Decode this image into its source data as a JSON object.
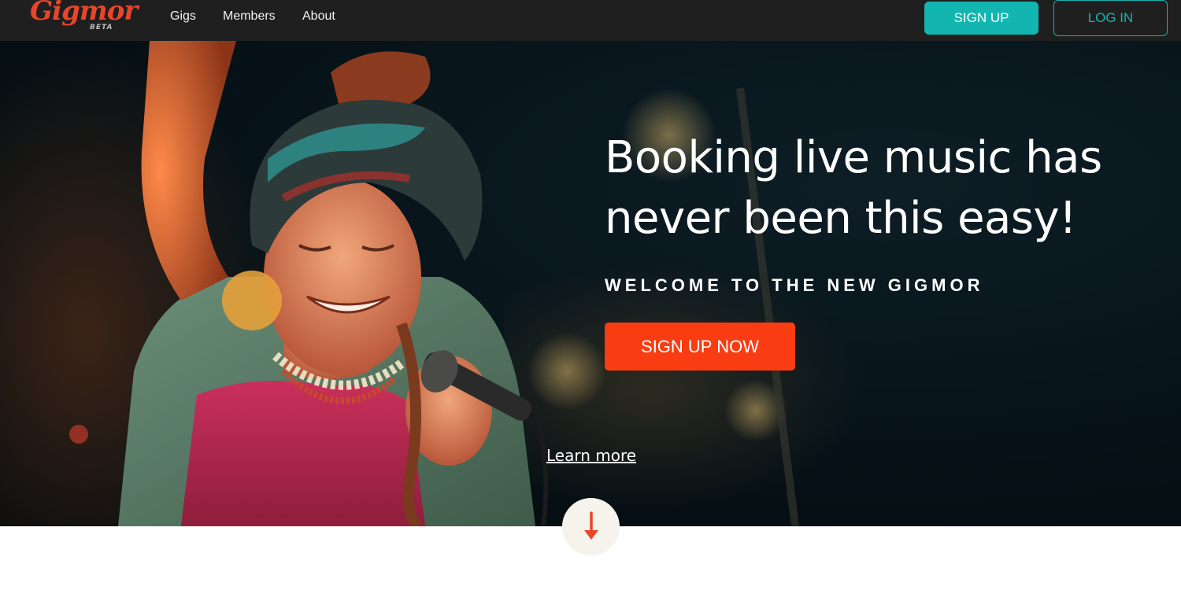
{
  "logo": {
    "word": "Gigmor",
    "badge": "BETA"
  },
  "nav": {
    "links": [
      "Gigs",
      "Members",
      "About"
    ],
    "signup_label": "SIGN UP",
    "login_label": "LOG IN"
  },
  "hero": {
    "headline_line1": "Booking live music has",
    "headline_line2": "never been this easy!",
    "subhead": "WELCOME TO THE NEW GIGMOR",
    "cta_label": "SIGN UP NOW",
    "learn_more": "Learn more"
  },
  "colors": {
    "nav_bg": "#1f1f1f",
    "teal": "#13b5b1",
    "cta_orange": "#fa3c12",
    "logo_red": "#e8452a"
  },
  "icons": {
    "scroll": "arrow-down-icon"
  }
}
